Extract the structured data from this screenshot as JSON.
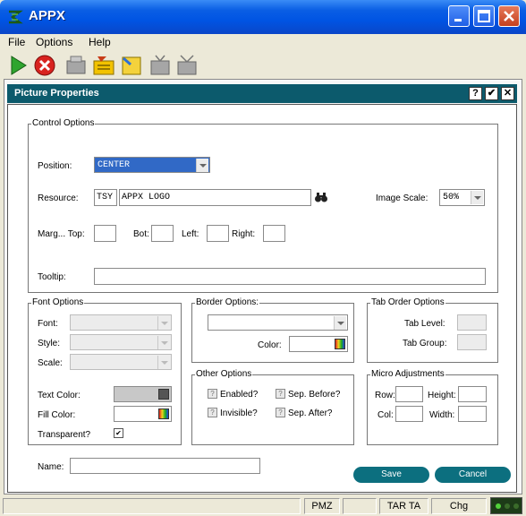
{
  "window": {
    "title": "APPX",
    "minimize_icon": "minimize-icon",
    "maximize_icon": "maximize-icon",
    "close_icon": "close-icon"
  },
  "menu": [
    {
      "label": "File"
    },
    {
      "label": "Options"
    },
    {
      "label": "Help"
    }
  ],
  "toolbar": {
    "icons": [
      "play-icon",
      "stop-icon",
      "print-icon",
      "edit-icon",
      "note-icon",
      "tv-icon",
      "tv2-icon"
    ]
  },
  "dialog": {
    "title": "Picture Properties",
    "help_label": "?",
    "ok_label": "✔",
    "close_label": "✕",
    "control_options": {
      "label": "Control Options",
      "position": {
        "label": "Position:",
        "value": "CENTER"
      },
      "resource": {
        "label": "Resource:",
        "prefix": "TSY",
        "value": "APPX LOGO"
      },
      "image_scale": {
        "label": "Image Scale:",
        "value": "50%"
      },
      "margins": {
        "label": "Marg... Top:",
        "top": "",
        "bot_label": "Bot:",
        "bot": "",
        "left_label": "Left:",
        "left": "",
        "right_label": "Right:",
        "right": ""
      },
      "tooltip": {
        "label": "Tooltip:",
        "value": ""
      }
    },
    "font_options": {
      "label": "Font Options",
      "font_label": "Font:",
      "style_label": "Style:",
      "scale_label": "Scale:",
      "text_color_label": "Text Color:",
      "fill_color_label": "Fill Color:",
      "transparent_label": "Transparent?",
      "transparent_checked": "✔"
    },
    "border_options": {
      "label": "Border Options:",
      "color_label": "Color:"
    },
    "tab_order_options": {
      "label": "Tab Order Options",
      "level_label": "Tab Level:",
      "group_label": "Tab Group:"
    },
    "other_options": {
      "label": "Other Options",
      "enabled_label": "Enabled?",
      "invisible_label": "Invisible?",
      "sep_before_label": "Sep. Before?",
      "sep_after_label": "Sep. After?",
      "check_mark": "?"
    },
    "micro_adjustments": {
      "label": "Micro Adjustments",
      "row_label": "Row:",
      "height_label": "Height:",
      "col_label": "Col:",
      "width_label": "Width:"
    },
    "name": {
      "label": "Name:",
      "value": ""
    },
    "save_label": "Save",
    "cancel_label": "Cancel"
  },
  "status": {
    "cells": [
      "PMZ",
      "",
      "TAR TA",
      "Chg"
    ]
  },
  "colors": {
    "title_bar": "#0054e3",
    "dialog_bar": "#0c5a6c",
    "button": "#0c6f7f",
    "selection": "#3169c6"
  }
}
